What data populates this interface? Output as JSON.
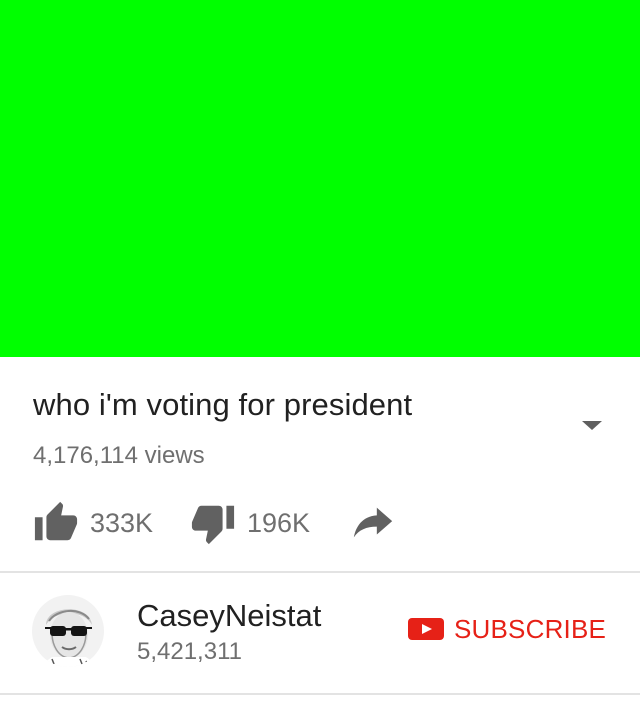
{
  "colors": {
    "player_background": "#00ff00",
    "brand_red": "#e62117",
    "icon_gray": "#616161",
    "secondary_text": "#6f6f6f",
    "primary_text": "#212121"
  },
  "video": {
    "title": "who i'm voting for president",
    "views": "4,176,114 views"
  },
  "actions": {
    "like": {
      "icon": "thumbs-up-icon",
      "count": "333K"
    },
    "dislike": {
      "icon": "thumbs-down-icon",
      "count": "196K"
    },
    "share": {
      "icon": "share-icon"
    }
  },
  "channel": {
    "name": "CaseyNeistat",
    "subscribers": "5,421,311"
  },
  "subscribe": {
    "icon": "youtube-play-icon",
    "label": "SUBSCRIBE"
  },
  "expand": {
    "icon": "caret-down-icon"
  }
}
